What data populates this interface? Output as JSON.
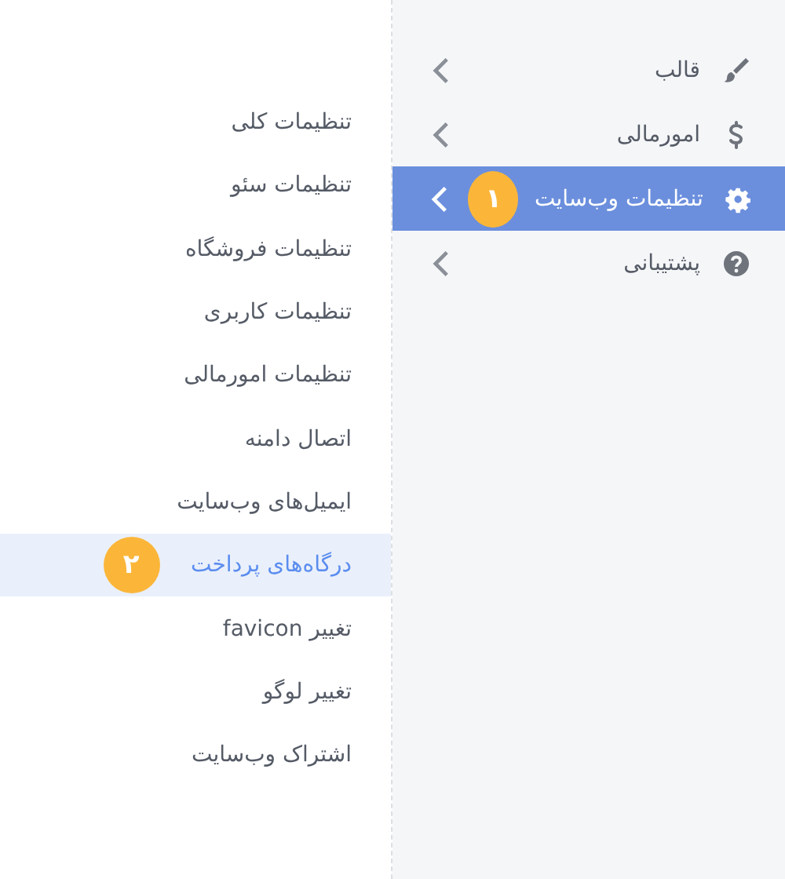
{
  "menu": {
    "items": [
      {
        "label": "قالب",
        "selected": false
      },
      {
        "label": "امورمالی",
        "selected": false
      },
      {
        "label": "تنظیمات وب‌سایت",
        "selected": true,
        "badge": "۱"
      },
      {
        "label": "پشتیبانی",
        "selected": false
      }
    ]
  },
  "submenu": {
    "items": [
      {
        "label": "تنظیمات کلی",
        "selected": false
      },
      {
        "label": "تنظیمات سئو",
        "selected": false
      },
      {
        "label": "تنظیمات فروشگاه",
        "selected": false
      },
      {
        "label": "تنظیمات کاربری",
        "selected": false
      },
      {
        "label": "تنظیمات امورمالی",
        "selected": false
      },
      {
        "label": "اتصال دامنه",
        "selected": false
      },
      {
        "label": "ایمیل‌های وب‌سایت",
        "selected": false
      },
      {
        "label": "درگاه‌های پرداخت",
        "selected": true,
        "badge": "۲"
      },
      {
        "label": "تغییر favicon",
        "selected": false
      },
      {
        "label": "تغییر لوگو",
        "selected": false
      },
      {
        "label": "اشتراک وب‌سایت",
        "selected": false
      }
    ]
  }
}
